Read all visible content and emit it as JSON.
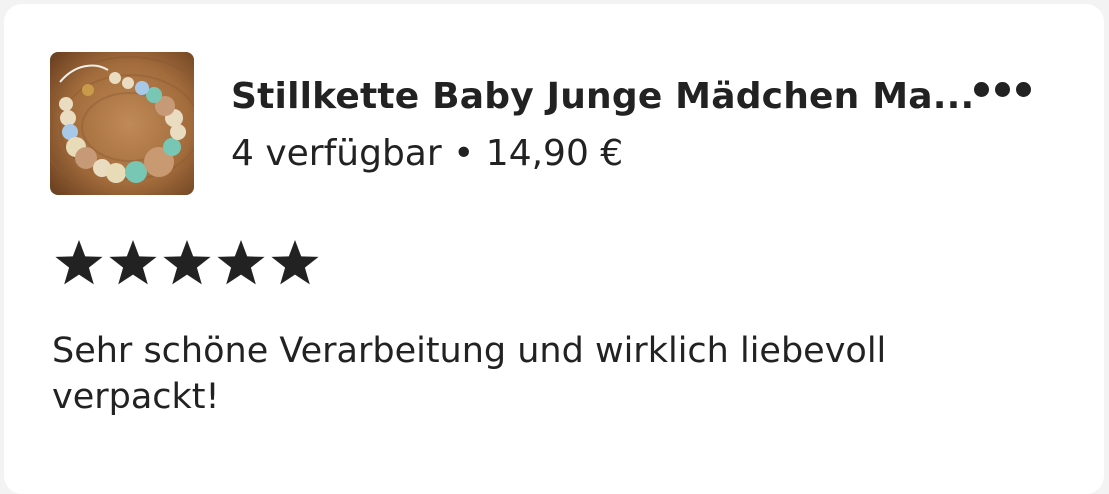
{
  "listing": {
    "title": "Stillkette Baby Junge Mädchen Ma...",
    "availability": "4 verfügbar",
    "separator": "•",
    "price": "14,90 €",
    "thumbnail_icon": "product-photo-nursing-necklace"
  },
  "menu": {
    "icon": "more-horizontal-icon"
  },
  "rating": {
    "value": 5,
    "max": 5,
    "color": "#222222"
  },
  "review": {
    "text": "Sehr schöne Verarbeitung und wirklich liebevoll verpackt!"
  }
}
